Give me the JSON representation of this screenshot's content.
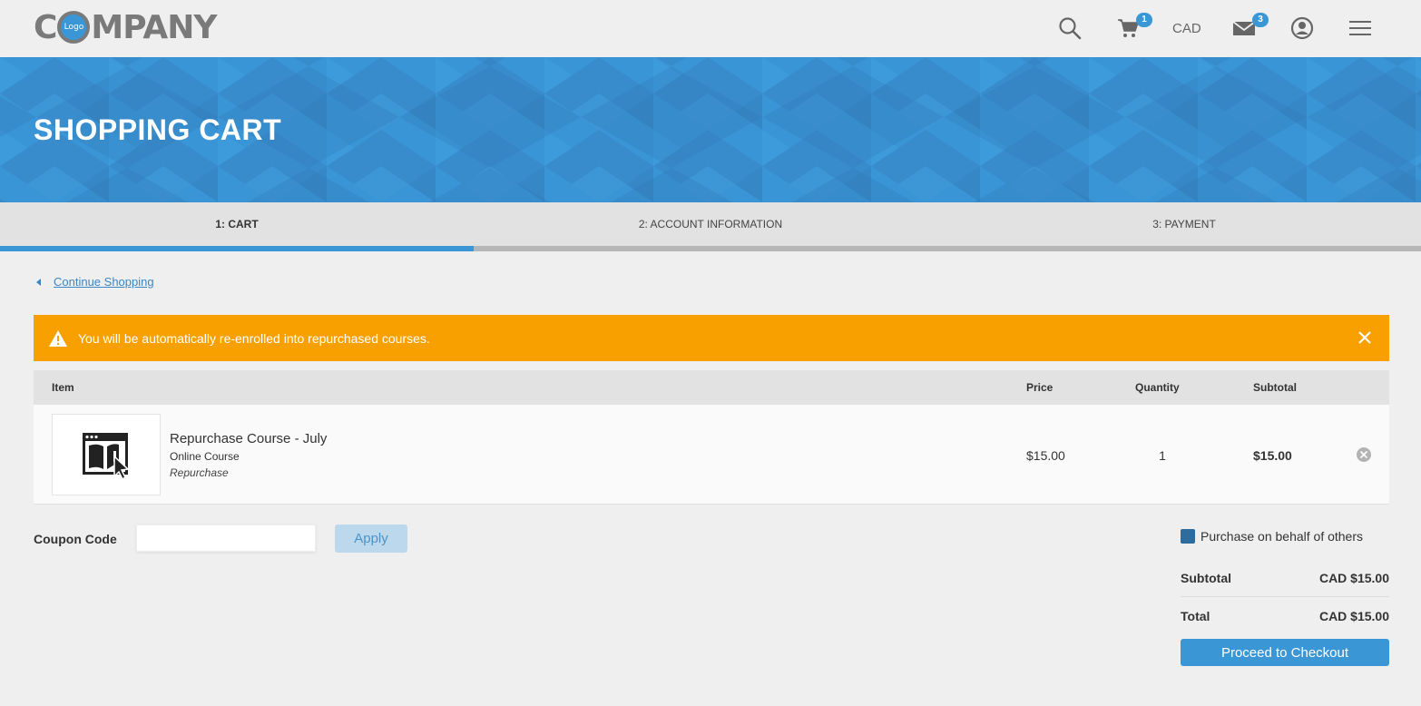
{
  "header": {
    "logo_text_pre": "C",
    "logo_badge": "Logo",
    "logo_text_post": "MPANY",
    "cart_count": "1",
    "currency": "CAD",
    "messages_count": "3",
    "icons": [
      "search-icon",
      "cart-icon",
      "mail-icon",
      "account-icon",
      "menu-icon"
    ]
  },
  "banner": {
    "title": "SHOPPING CART"
  },
  "steps": [
    {
      "label": "1: CART",
      "active": true
    },
    {
      "label": "2: ACCOUNT INFORMATION",
      "active": false
    },
    {
      "label": "3: PAYMENT",
      "active": false
    }
  ],
  "continue_shopping": "Continue Shopping",
  "alert": {
    "message": "You will be automatically re-enrolled into repurchased courses."
  },
  "table": {
    "headers": {
      "item": "Item",
      "price": "Price",
      "quantity": "Quantity",
      "subtotal": "Subtotal"
    },
    "rows": [
      {
        "name": "Repurchase Course - July",
        "type": "Online Course",
        "note": "Repurchase",
        "price": "$15.00",
        "quantity": "1",
        "subtotal": "$15.00"
      }
    ]
  },
  "coupon": {
    "label": "Coupon Code",
    "value": "",
    "placeholder": "",
    "apply_label": "Apply"
  },
  "summary": {
    "behalf_label": "Purchase on behalf of others",
    "subtotal_label": "Subtotal",
    "subtotal_value": "CAD $15.00",
    "total_label": "Total",
    "total_value": "CAD $15.00",
    "checkout_label": "Proceed to Checkout"
  },
  "colors": {
    "accent": "#3a96d4",
    "alert": "#f7a000",
    "checkbox": "#2d6c9c"
  }
}
